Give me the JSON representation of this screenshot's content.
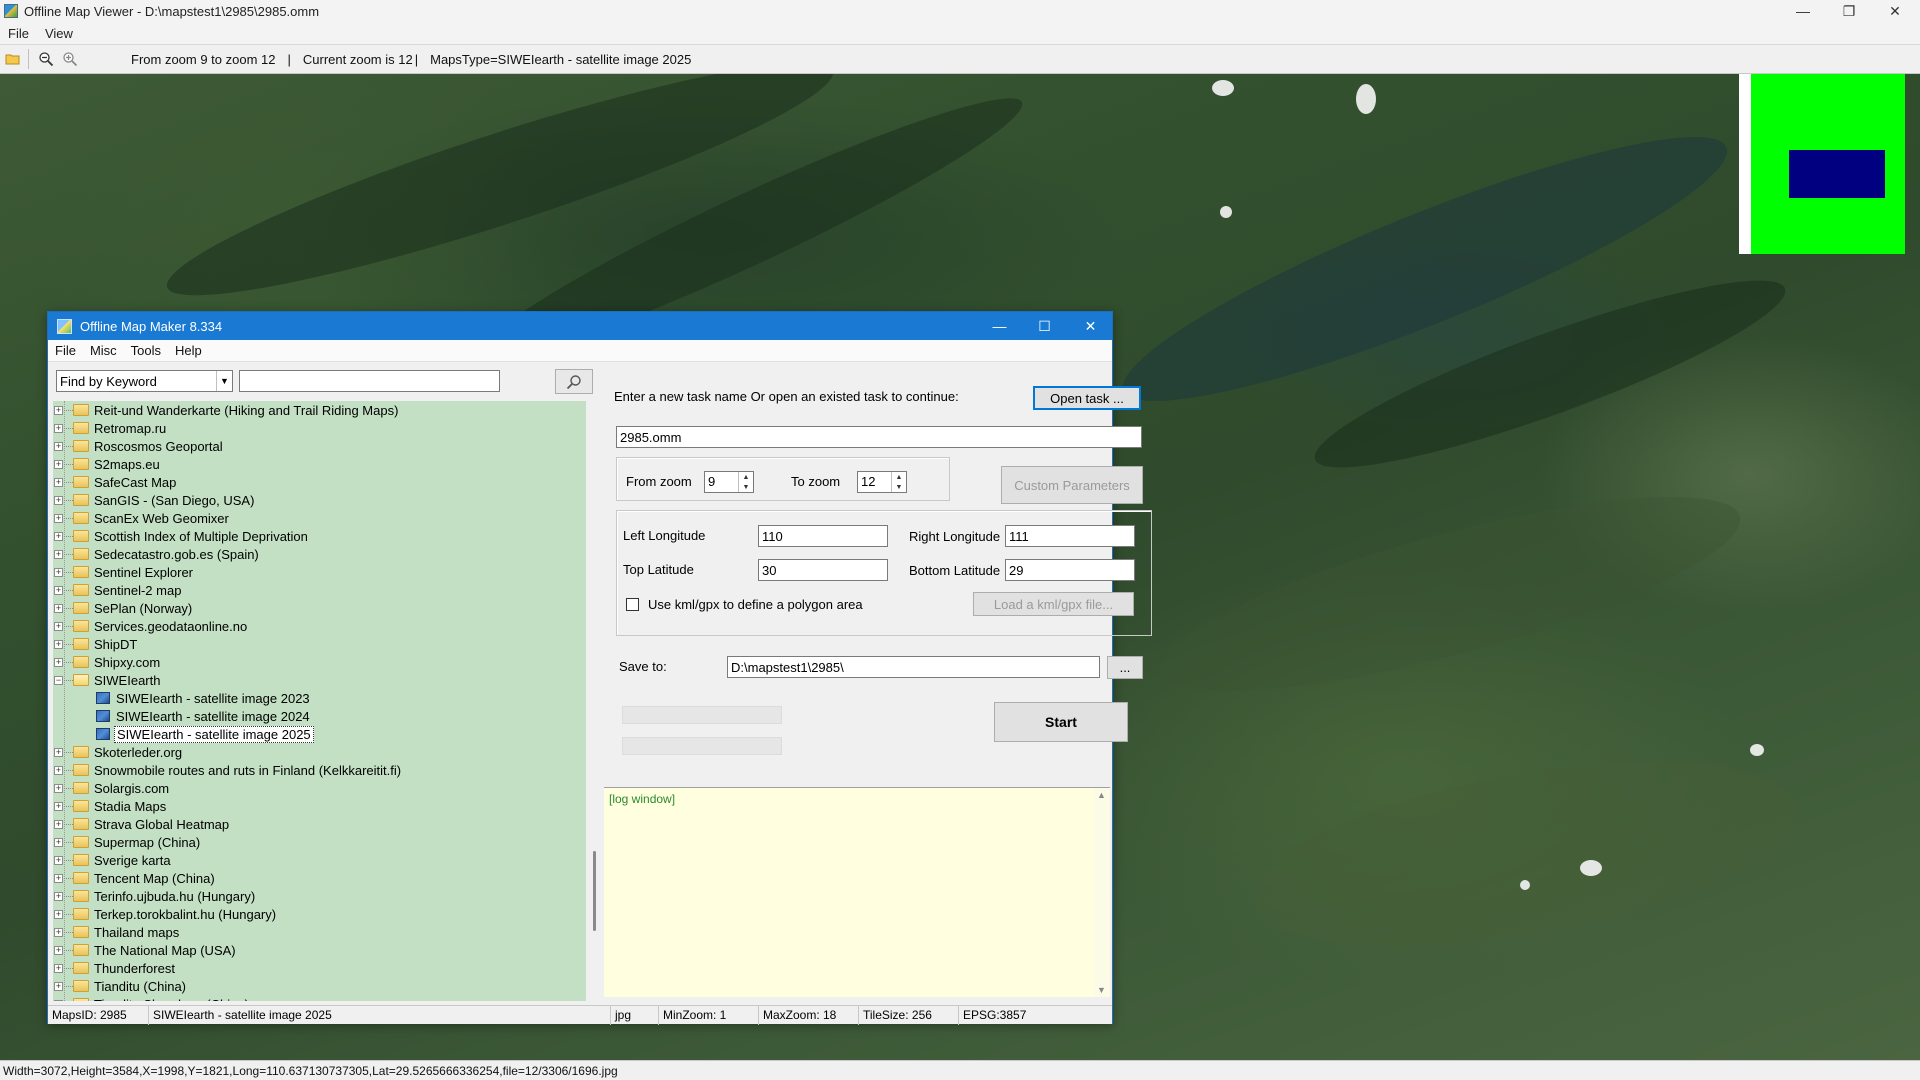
{
  "window": {
    "title": "Offline Map Viewer - D:\\mapstest1\\2985\\2985.omm",
    "minimize": "—",
    "maximize": "❐",
    "close": "✕"
  },
  "menu": {
    "file": "File",
    "view": "View"
  },
  "toolbar": {
    "zoom_range": "From zoom 9 to zoom 12",
    "current_zoom": "Current zoom is 12",
    "maps_type": "MapsType=SIWEIearth - satellite image 2025",
    "divider": "|"
  },
  "status": {
    "text": "Width=3072,Height=3584,X=1998,Y=1821,Long=110.637130737305,Lat=29.5265666336254,file=12/3306/1696.jpg"
  },
  "minimap": {
    "background": "#00ff00",
    "viewport": "#000080"
  },
  "dialog": {
    "title": "Offline Map Maker 8.334",
    "minimize": "—",
    "maximize": "☐",
    "close": "✕",
    "menu": {
      "file": "File",
      "misc": "Misc",
      "tools": "Tools",
      "help": "Help"
    },
    "search": {
      "mode": "Find by Keyword",
      "value": "",
      "button_icon": "search-icon"
    },
    "tree": [
      {
        "label": "Reit-und Wanderkarte (Hiking and Trail Riding Maps)"
      },
      {
        "label": "Retromap.ru"
      },
      {
        "label": "Roscosmos Geoportal"
      },
      {
        "label": "S2maps.eu"
      },
      {
        "label": "SafeCast Map"
      },
      {
        "label": "SanGIS - (San Diego, USA)"
      },
      {
        "label": "ScanEx Web Geomixer"
      },
      {
        "label": "Scottish Index of Multiple Deprivation"
      },
      {
        "label": "Sedecatastro.gob.es (Spain)"
      },
      {
        "label": "Sentinel Explorer"
      },
      {
        "label": "Sentinel-2 map"
      },
      {
        "label": "SePlan (Norway)"
      },
      {
        "label": "Services.geodataonline.no"
      },
      {
        "label": "ShipDT"
      },
      {
        "label": "Shipxy.com"
      },
      {
        "label": "SIWEIearth",
        "expanded": true
      },
      {
        "label": "SIWEIearth - satellite image 2023",
        "child": true
      },
      {
        "label": "SIWEIearth - satellite image 2024",
        "child": true
      },
      {
        "label": "SIWEIearth - satellite image 2025",
        "child": true,
        "selected": true
      },
      {
        "label": "Skoterleder.org"
      },
      {
        "label": "Snowmobile routes and ruts in Finland (Kelkkareitit.fi)"
      },
      {
        "label": "Solargis.com"
      },
      {
        "label": "Stadia Maps"
      },
      {
        "label": "Strava Global Heatmap"
      },
      {
        "label": "Supermap (China)"
      },
      {
        "label": "Sverige karta"
      },
      {
        "label": "Tencent Map (China)"
      },
      {
        "label": "Terinfo.ujbuda.hu (Hungary)"
      },
      {
        "label": "Terkep.torokbalint.hu (Hungary)"
      },
      {
        "label": "Thailand maps"
      },
      {
        "label": "The National Map (USA)"
      },
      {
        "label": "Thunderforest"
      },
      {
        "label": "Tianditu (China)"
      },
      {
        "label": "Tianditu Shandong (China)"
      }
    ],
    "task": {
      "prompt": "Enter a new task name Or open an existed task to continue:",
      "open_button": "Open task ...",
      "name": "2985.omm"
    },
    "zoom": {
      "from_label": "From zoom",
      "from_value": "9",
      "to_label": "To zoom",
      "to_value": "12",
      "custom_button": "Custom Parameters"
    },
    "area": {
      "left_lon_label": "Left Longitude",
      "left_lon": "110",
      "right_lon_label": "Right Longitude",
      "right_lon": "111",
      "top_lat_label": "Top Latitude",
      "top_lat": "30",
      "bottom_lat_label": "Bottom Latitude",
      "bottom_lat": "29",
      "kml_checkbox_label": "Use kml/gpx to define a polygon area",
      "kml_checked": false,
      "kml_button": "Load a kml/gpx file..."
    },
    "save": {
      "label": "Save to:",
      "path": "D:\\mapstest1\\2985\\",
      "browse": "..."
    },
    "start_button": "Start",
    "log": {
      "text": "[log window]"
    },
    "status": {
      "maps_id": "MapsID: 2985",
      "map_name": "SIWEIearth - satellite image 2025",
      "format": "jpg",
      "min_zoom": "MinZoom: 1",
      "max_zoom": "MaxZoom: 18",
      "tile_size": "TileSize: 256",
      "epsg": "EPSG:3857"
    }
  }
}
